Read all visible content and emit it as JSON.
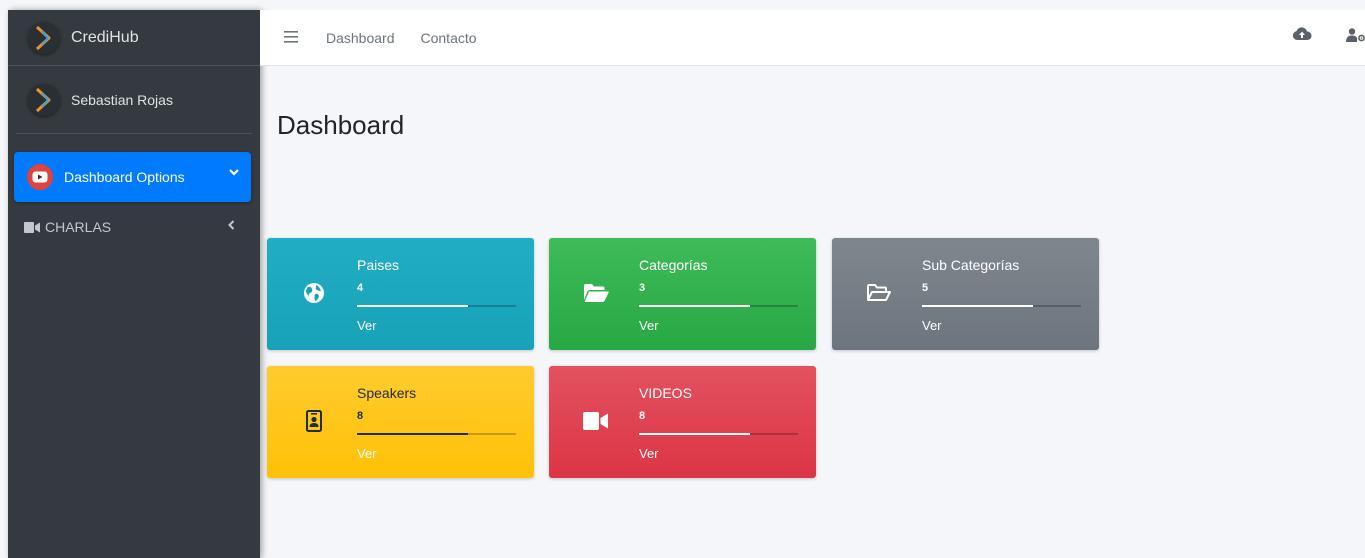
{
  "sidebar": {
    "brand": "CrediHub",
    "user_name": "Sebastian Rojas",
    "active_item": {
      "label": "Dashboard Options",
      "icon": "youtube-icon"
    },
    "items": [
      {
        "label": "CHARLAS",
        "icon": "video-icon"
      }
    ]
  },
  "navbar": {
    "links": [
      "Dashboard",
      "Contacto"
    ],
    "right_icons": [
      "cloud-upload-icon",
      "user-cog-icon"
    ]
  },
  "main": {
    "title": "Dashboard",
    "cards": [
      {
        "title": "Paises",
        "count": "4",
        "link": "Ver",
        "icon": "globe-icon",
        "color": "#17a2b8",
        "progress": 0.7
      },
      {
        "title": "Categorías",
        "count": "3",
        "link": "Ver",
        "icon": "folder-open-icon",
        "color": "#28a745",
        "progress": 0.7
      },
      {
        "title": "Sub Categorías",
        "count": "5",
        "link": "Ver",
        "icon": "folder-open-outline-icon",
        "color": "#6c757d",
        "progress": 0.7
      },
      {
        "title": "Speakers",
        "count": "8",
        "link": "Ver",
        "icon": "id-badge-icon",
        "color": "#ffc107",
        "progress": 0.7
      },
      {
        "title": "VIDEOS",
        "count": "8",
        "link": "Ver",
        "icon": "video-camera-icon",
        "color": "#dc3545",
        "progress": 0.7
      }
    ]
  },
  "colors": {
    "sidebar_bg": "#343a40",
    "primary": "#007bff",
    "content_bg": "#f4f6f9"
  }
}
